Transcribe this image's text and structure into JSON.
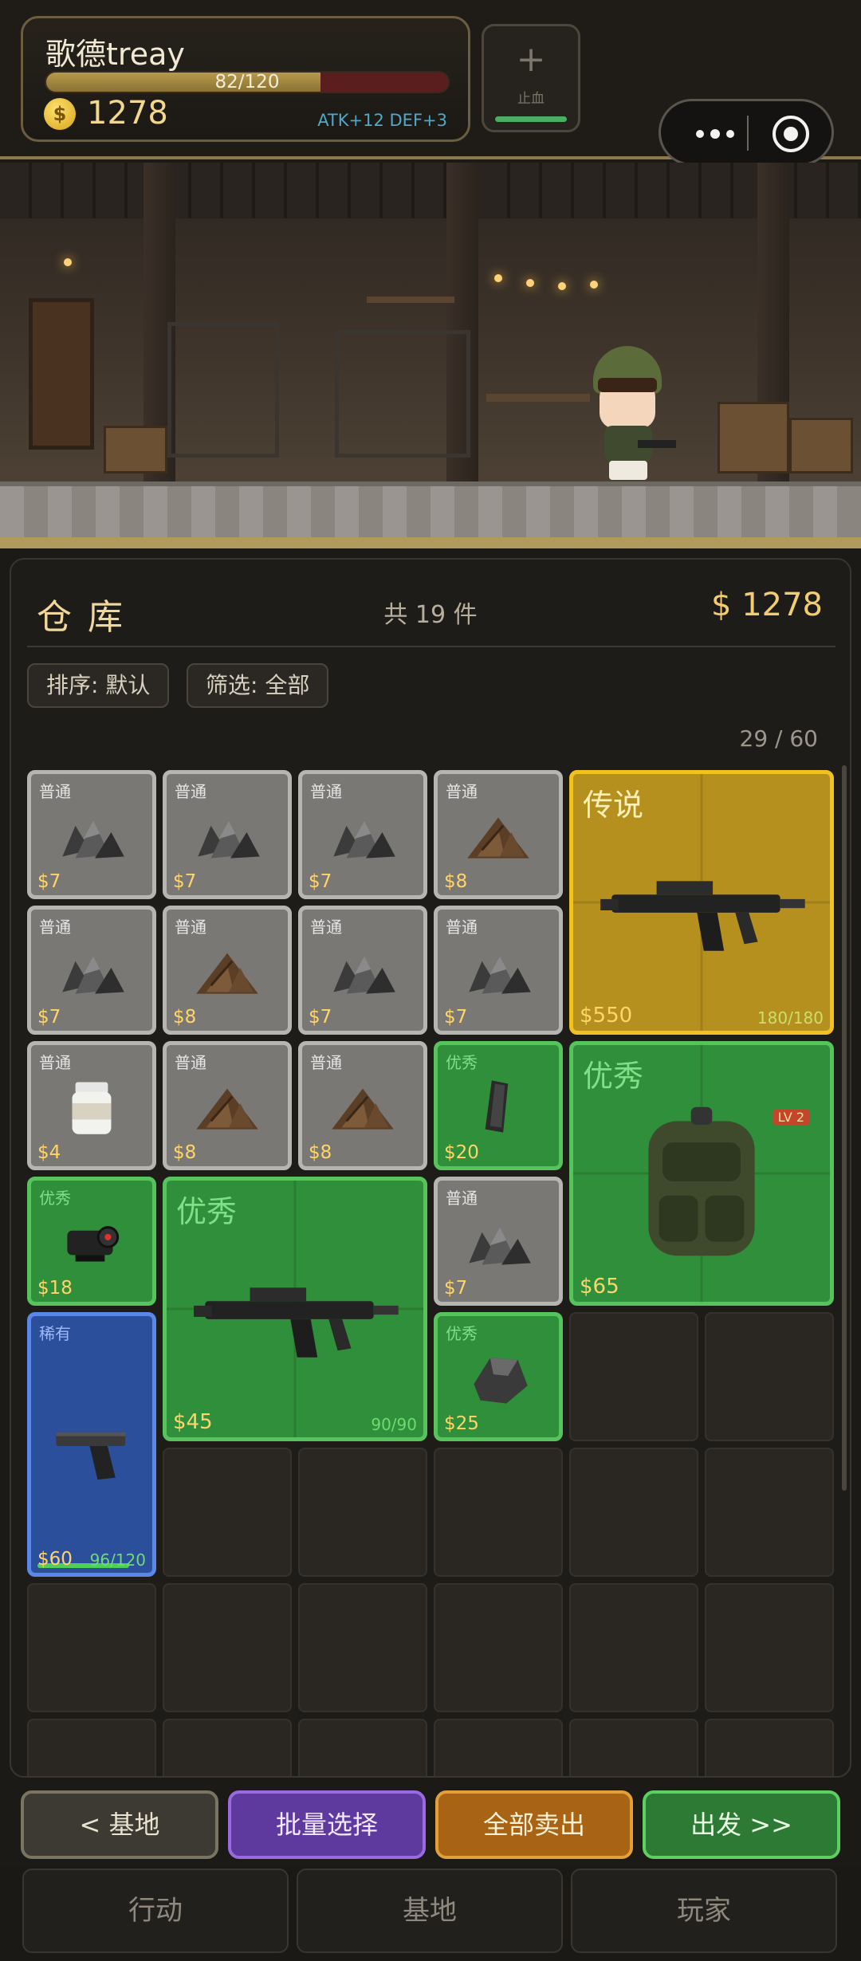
{
  "player": {
    "name": "歌德treay",
    "hp_text": "82/120",
    "hp_fraction": 0.683,
    "coins": "1278",
    "coin_symbol": "$",
    "stats": "ATK+12 DEF+3"
  },
  "heal": {
    "plus": "+",
    "label": "止血"
  },
  "warehouse": {
    "title": "仓库",
    "total": "共 19 件",
    "money": "$ 1278",
    "sort_label": "排序: 默认",
    "filter_label": "筛选: 全部",
    "capacity": "29 / 60"
  },
  "items": [
    {
      "name": "ore-scrap",
      "rarity": "普通",
      "price": "$7",
      "tier": "common",
      "icon": "rock-pile"
    },
    {
      "name": "ore-scrap",
      "rarity": "普通",
      "price": "$7",
      "tier": "common",
      "icon": "rock-pile"
    },
    {
      "name": "ore-scrap",
      "rarity": "普通",
      "price": "$7",
      "tier": "common",
      "icon": "rock-pile"
    },
    {
      "name": "wood-scrap",
      "rarity": "普通",
      "price": "$8",
      "tier": "common",
      "icon": "wood-pile"
    },
    {
      "name": "legend-smg",
      "rarity": "传说",
      "price": "$550",
      "tier": "legend",
      "icon": "submachine-gun",
      "durability": "180/180",
      "durability_fraction": 1.0
    },
    {
      "name": "ore-scrap",
      "rarity": "普通",
      "price": "$7",
      "tier": "common",
      "icon": "rock-pile"
    },
    {
      "name": "wood-scrap",
      "rarity": "普通",
      "price": "$8",
      "tier": "common",
      "icon": "wood-pile"
    },
    {
      "name": "ore-scrap",
      "rarity": "普通",
      "price": "$7",
      "tier": "common",
      "icon": "rock-pile"
    },
    {
      "name": "ore-scrap",
      "rarity": "普通",
      "price": "$7",
      "tier": "common",
      "icon": "rock-pile"
    },
    {
      "name": "painkillers",
      "rarity": "普通",
      "price": "$4",
      "tier": "common",
      "icon": "pill-bottle"
    },
    {
      "name": "wood-scrap",
      "rarity": "普通",
      "price": "$8",
      "tier": "common",
      "icon": "wood-pile"
    },
    {
      "name": "wood-scrap",
      "rarity": "普通",
      "price": "$8",
      "tier": "common",
      "icon": "wood-pile"
    },
    {
      "name": "magazine",
      "rarity": "优秀",
      "price": "$20",
      "tier": "excellent",
      "icon": "magazine"
    },
    {
      "name": "backpack",
      "rarity": "优秀",
      "price": "$65",
      "tier": "excellent",
      "icon": "backpack",
      "badge": "LV 2"
    },
    {
      "name": "red-dot-sight",
      "rarity": "优秀",
      "price": "$18",
      "tier": "excellent",
      "icon": "red-dot-sight"
    },
    {
      "name": "excellent-smg",
      "rarity": "优秀",
      "price": "$45",
      "tier": "excellent",
      "icon": "submachine-gun",
      "durability": "90/90",
      "durability_fraction": 1.0
    },
    {
      "name": "ore-scrap",
      "rarity": "普通",
      "price": "$7",
      "tier": "common",
      "icon": "rock-pile"
    },
    {
      "name": "rare-pistol",
      "rarity": "稀有",
      "price": "$60",
      "tier": "rare",
      "icon": "pistol",
      "durability": "96/120",
      "durability_fraction": 0.8
    },
    {
      "name": "metal-ore",
      "rarity": "优秀",
      "price": "$25",
      "tier": "excellent",
      "icon": "ore-chunk"
    }
  ],
  "actions": {
    "base_back": "< 基地",
    "batch_select": "批量选择",
    "sell_all": "全部卖出",
    "depart": "出发 >>"
  },
  "nav": {
    "action": "行动",
    "base": "基地",
    "player": "玩家"
  },
  "colors": {
    "common": "#7a7875",
    "excellent": "#2f8f3a",
    "rare": "#2c4f9c",
    "legend": "#b5901f",
    "gold_text": "#f2cc70"
  }
}
